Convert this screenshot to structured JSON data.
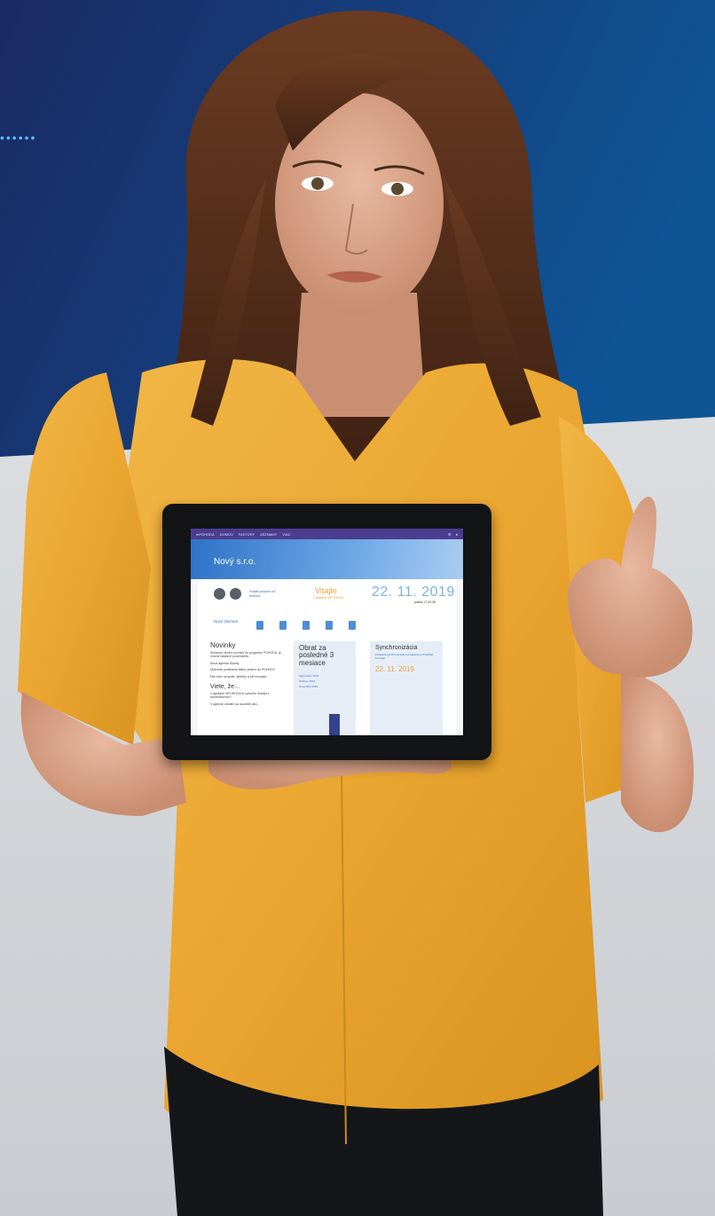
{
  "background": {
    "top_color": "#173a78",
    "bottom_color": "#dcdfe3",
    "dots": "••••••"
  },
  "tablet_app": {
    "brand": "mPOHODA",
    "menu": [
      "DOMOV",
      "FAKTÚRY",
      "ZÁZNAMY",
      "VIAC"
    ],
    "company": "Nový s.r.o.",
    "welcome": "Vitajte",
    "welcome_sub": "v aplikácii mPOHODA",
    "date": "22. 11. 2019",
    "time": "piatok 17:00:38",
    "support_text": "Volajte podporu na telefóne",
    "new_document_label": "Nový záznam",
    "news_title": "Novinky",
    "news_lines": [
      "Súčasne mnoho inovácií do programu POHODA, je možné nastaviť používateľa.",
      "Nová agenda Služby.",
      "Možnosti posielania faktúr priamo do POHODY.",
      "Diel ktorí na grafe, tabuľky a iné inovácie."
    ],
    "tip_title": "Viete, že…",
    "tip_lines": [
      "V aplikácii mPOHODA si vytvoríte doklad z ktoréhokoľvek?",
      "V agende odmien sa dozviete ako…"
    ],
    "turnover_title": "Obrat za posledné 3 mesiace",
    "turnover_rows": [
      "September 2019",
      "Október 2019",
      "November 2019"
    ],
    "sync_title": "Synchronizácia",
    "sync_text": "Posledná synchronizácia s programom POHODA Komplet",
    "sync_date": "22. 11. 2019"
  }
}
